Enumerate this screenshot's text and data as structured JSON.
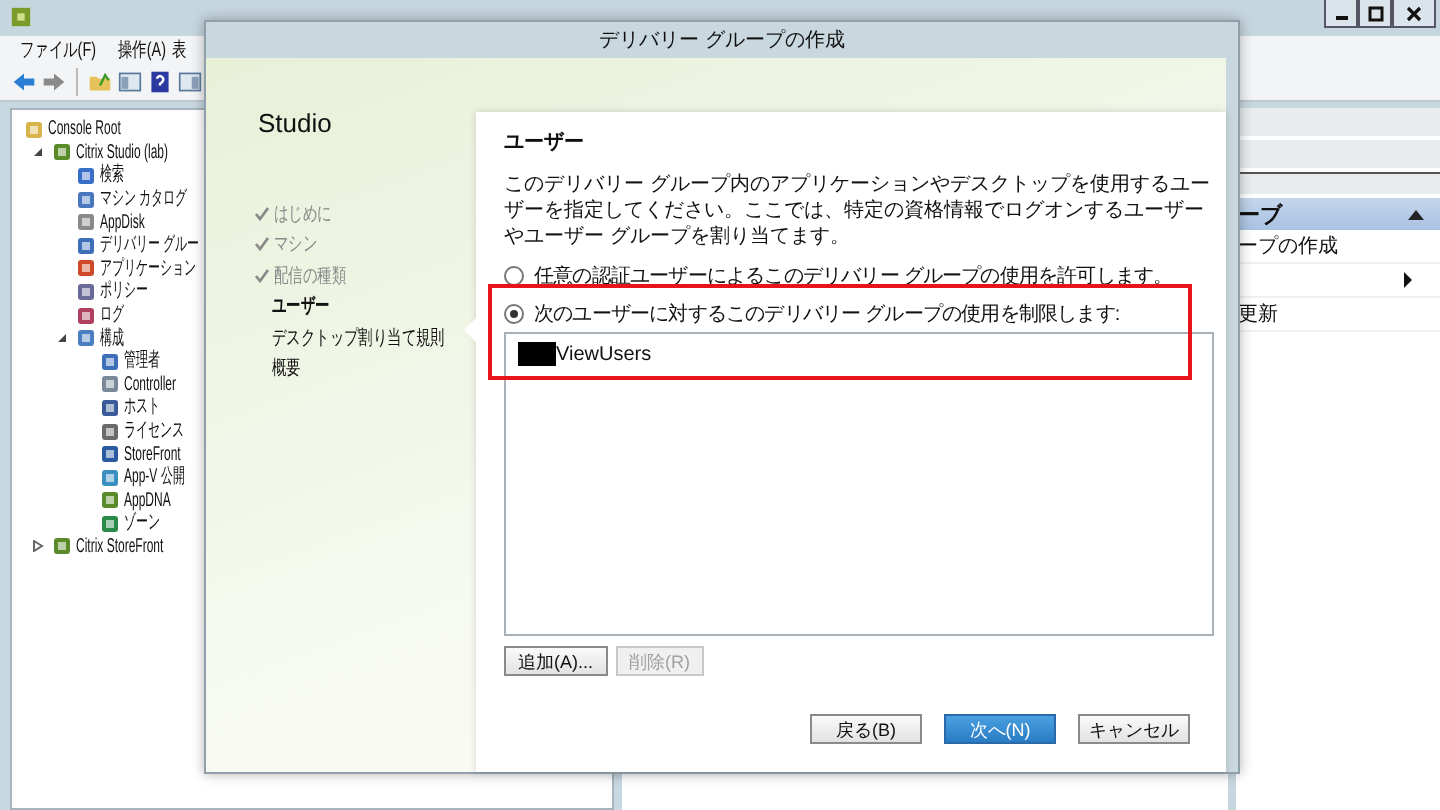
{
  "menu": [
    "ファイル(F)",
    "操作(A)",
    "表"
  ],
  "tree": [
    {
      "label": "Console Root",
      "children": [
        {
          "label": "Citrix Studio (lab)",
          "expanded": true,
          "children": [
            {
              "label": "検索"
            },
            {
              "label": "マシン カタログ"
            },
            {
              "label": "AppDisk"
            },
            {
              "label": "デリバリー グルー"
            },
            {
              "label": "アプリケーション"
            },
            {
              "label": "ポリシー"
            },
            {
              "label": "ログ"
            },
            {
              "label": "構成",
              "expanded": true,
              "children": [
                {
                  "label": "管理者"
                },
                {
                  "label": "Controller"
                },
                {
                  "label": "ホスト"
                },
                {
                  "label": "ライセンス"
                },
                {
                  "label": "StoreFront"
                },
                {
                  "label": "App-V 公開"
                },
                {
                  "label": "AppDNA"
                },
                {
                  "label": "ゾーン"
                }
              ]
            }
          ]
        },
        {
          "label": "Citrix StoreFront",
          "expanded": false
        }
      ]
    }
  ],
  "actions_panel": {
    "header": "ーブ",
    "expanded": true,
    "items": [
      {
        "label": "ープの作成",
        "submenu": false
      },
      {
        "submenu": true
      },
      {
        "label": "更新",
        "submenu": false
      }
    ]
  },
  "dialog": {
    "title": "デリバリー グループの作成",
    "product": "Studio",
    "steps": [
      {
        "label": "はじめに",
        "done": true,
        "selected": false
      },
      {
        "label": "マシン",
        "done": true,
        "selected": false
      },
      {
        "label": "配信の種類",
        "done": true,
        "selected": false
      },
      {
        "label": "ユーザー",
        "done": false,
        "selected": true
      },
      {
        "label": "デスクトップ割り当て規則",
        "done": false,
        "selected": false
      },
      {
        "label": "概要",
        "done": false,
        "selected": false
      }
    ],
    "page": {
      "heading": "ユーザー",
      "description": "このデリバリー グループ内のアプリケーションやデスクトップを使用するユーザーを指定してください。ここでは、特定の資格情報でログオンするユーザーやユーザー グループを割り当てます。",
      "options": [
        {
          "label": "任意の認証ユーザーによるこのデリバリー グループの使用を許可します。",
          "selected": false
        },
        {
          "label": "次のユーザーに対するこのデリバリー グループの使用を制限します:",
          "selected": true
        }
      ],
      "users": [
        {
          "name": "ViewUsers",
          "redacted": true
        }
      ],
      "list_buttons": [
        {
          "label": "追加(A)...",
          "disabled": false
        },
        {
          "label": "削除(R)",
          "disabled": true
        }
      ]
    },
    "footer_buttons": [
      {
        "label": "戻る(B)",
        "kind": "default"
      },
      {
        "label": "次へ(N)",
        "kind": "primary"
      },
      {
        "label": "キャンセル",
        "kind": "default"
      }
    ]
  }
}
